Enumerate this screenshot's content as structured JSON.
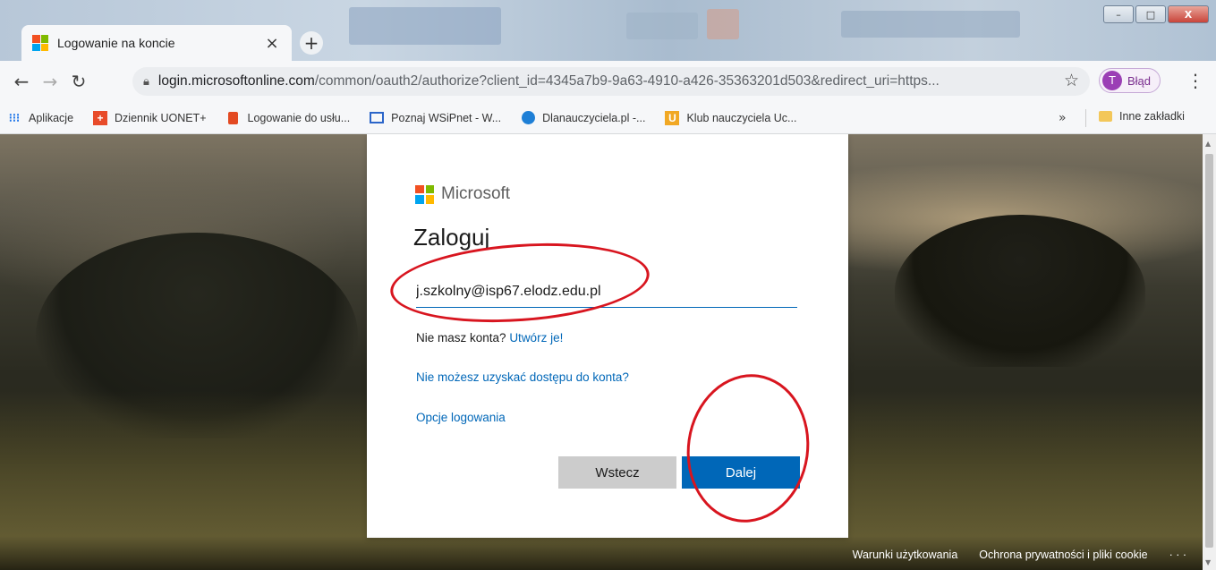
{
  "browser": {
    "tab": {
      "title": "Logowanie na koncie",
      "close_icon": "×"
    },
    "new_tab_icon": "+",
    "window_controls": {
      "minimize": "–",
      "maximize": "□",
      "close": "X"
    },
    "address": {
      "host": "login.microsoftonline.com",
      "path": "/common/oauth2/authorize?client_id=4345a7b9-9a63-4910-a426-35363201d503&redirect_uri=https..."
    },
    "profile": {
      "initial": "T",
      "label": "Błąd"
    },
    "bookmarks": [
      {
        "label": "Aplikacje",
        "icon": "apps-grid-icon"
      },
      {
        "label": "Dziennik UONET+",
        "icon": "uonet-icon"
      },
      {
        "label": "Logowanie do usłu...",
        "icon": "office-icon"
      },
      {
        "label": "Poznaj WSiPnet - W...",
        "icon": "monitor-icon"
      },
      {
        "label": "Dlanauczyciela.pl -...",
        "icon": "blue-dot-icon"
      },
      {
        "label": "Klub nauczyciela Uc...",
        "icon": "u-badge-icon"
      }
    ],
    "bookmarks_more": "»",
    "other_bookmarks": "Inne zakładki"
  },
  "signin": {
    "brand": "Microsoft",
    "heading": "Zaloguj",
    "email_value": "j.szkolny@isp67.elodz.edu.pl",
    "no_account_text": "Nie masz konta?",
    "create_link": "Utwórz je!",
    "cant_access_link": "Nie możesz uzyskać dostępu do konta?",
    "signin_options_link": "Opcje logowania",
    "back_button": "Wstecz",
    "next_button": "Dalej"
  },
  "footer": {
    "terms": "Warunki użytkowania",
    "privacy": "Ochrona prywatności i pliki cookie",
    "more": "· · ·"
  },
  "colors": {
    "accent": "#0067b8",
    "annotation_red": "#d8151f",
    "ms_red": "#f25022",
    "ms_green": "#7fba00",
    "ms_blue": "#00a4ef",
    "ms_yellow": "#ffb900"
  }
}
